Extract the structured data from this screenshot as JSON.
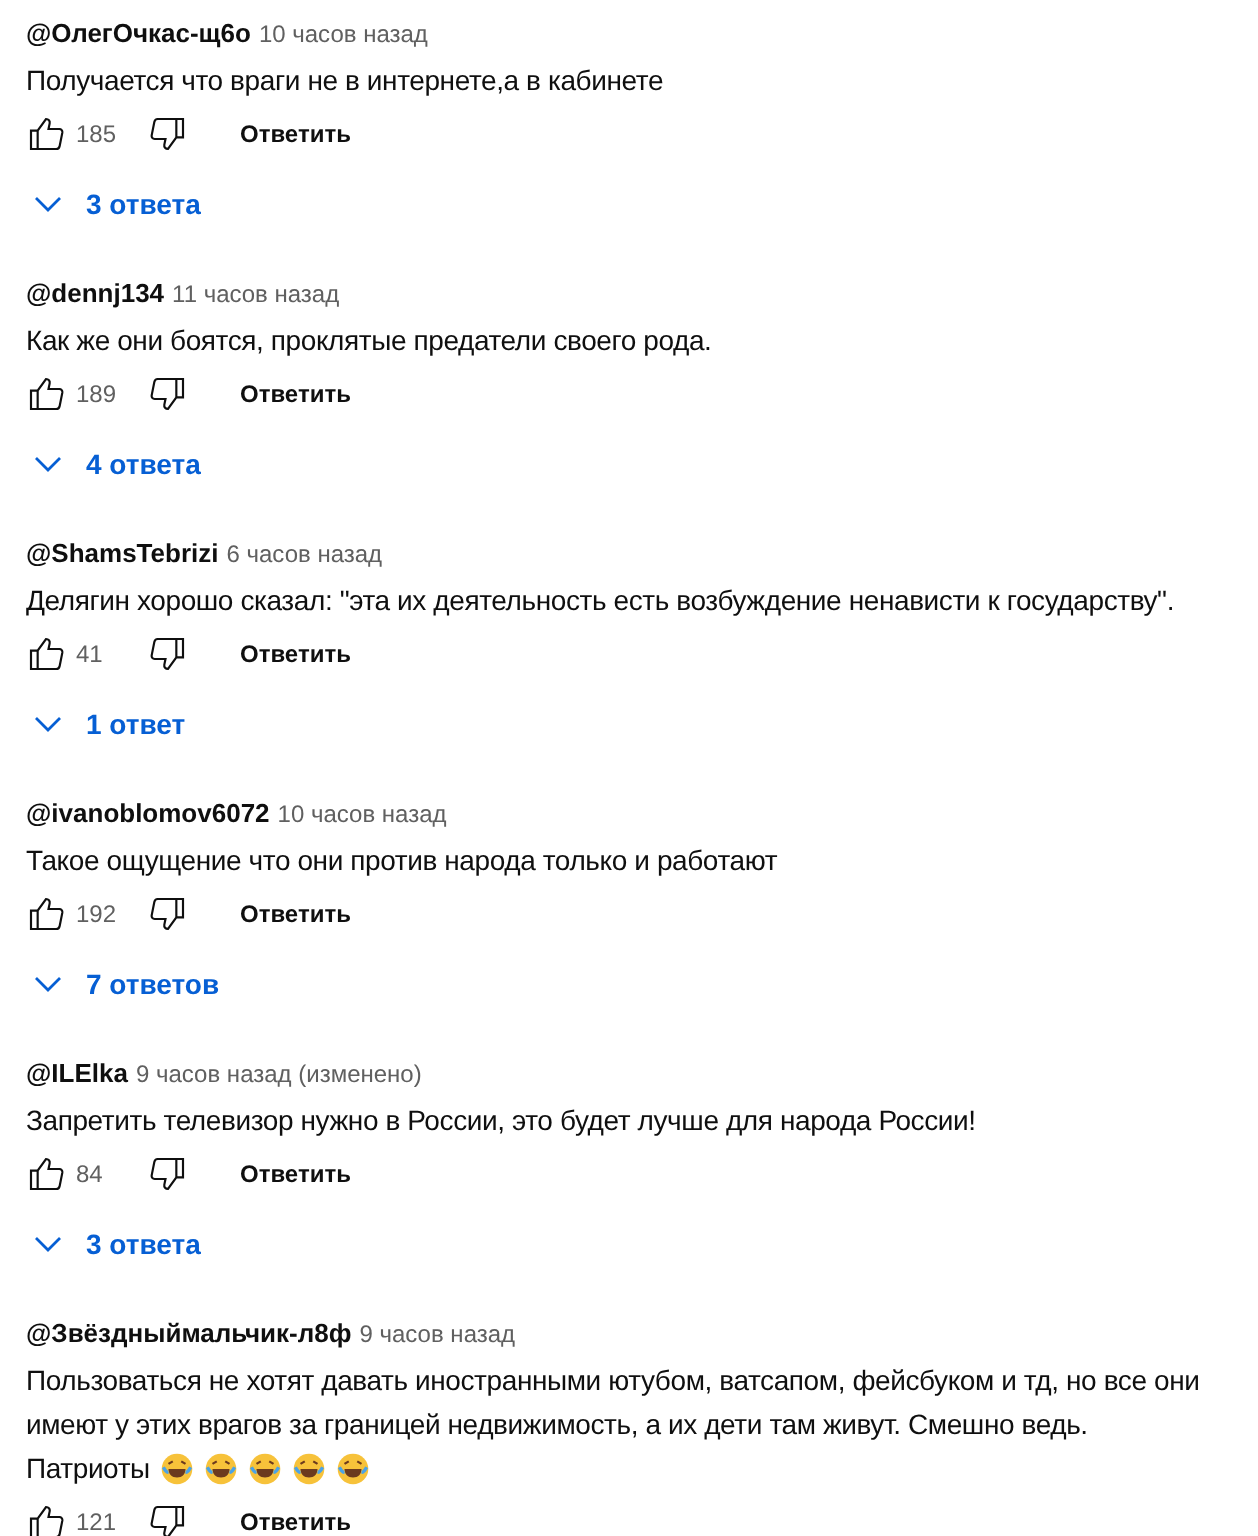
{
  "comments": [
    {
      "author": "@ОлегОчкас-щ6о",
      "time": "10 часов назад",
      "lines": [
        "Получается что враги не в интернете,а в кабинете"
      ],
      "likes": "185",
      "reply_label": "Ответить",
      "replies": "3 ответа"
    },
    {
      "author": "@dennj134",
      "time": "11 часов назад",
      "lines": [
        "Как же они боятся, проклятые предатели своего рода."
      ],
      "likes": "189",
      "reply_label": "Ответить",
      "replies": "4 ответа"
    },
    {
      "author": "@ShamsTebrizi",
      "time": "6 часов назад",
      "lines": [
        "Делягин хорошо сказал: \"эта их деятельность есть возбуждение ненависти к государству\"."
      ],
      "likes": "41",
      "reply_label": "Ответить",
      "replies": "1 ответ"
    },
    {
      "author": "@ivanoblomov6072",
      "time": "10 часов назад",
      "lines": [
        "Такое ощущение что они против народа только и работают"
      ],
      "likes": "192",
      "reply_label": "Ответить",
      "replies": "7 ответов"
    },
    {
      "author": "@ILElka",
      "time": "9 часов назад (изменено)",
      "lines": [
        "Запретить телевизор нужно в России, это будет лучше для народа России!"
      ],
      "likes": "84",
      "reply_label": "Ответить",
      "replies": "3 ответа"
    },
    {
      "author": "@Звёздныймальчик-л8ф",
      "time": "9 часов назад",
      "lines": [
        "Пользоваться не хотят давать иностранными ютубом, ватсапом, фейсбуком и тд, но все они",
        "имеют у этих врагов за границей недвижимость, а их дети там живут. Смешно ведь.",
        "Патриоты"
      ],
      "emojis": [
        {
          "kind": "laughing"
        },
        {
          "kind": "laughing"
        },
        {
          "kind": "laughing"
        },
        {
          "kind": "laughing"
        },
        {
          "kind": "laughing"
        }
      ],
      "likes": "121",
      "reply_label": "Ответить"
    }
  ]
}
